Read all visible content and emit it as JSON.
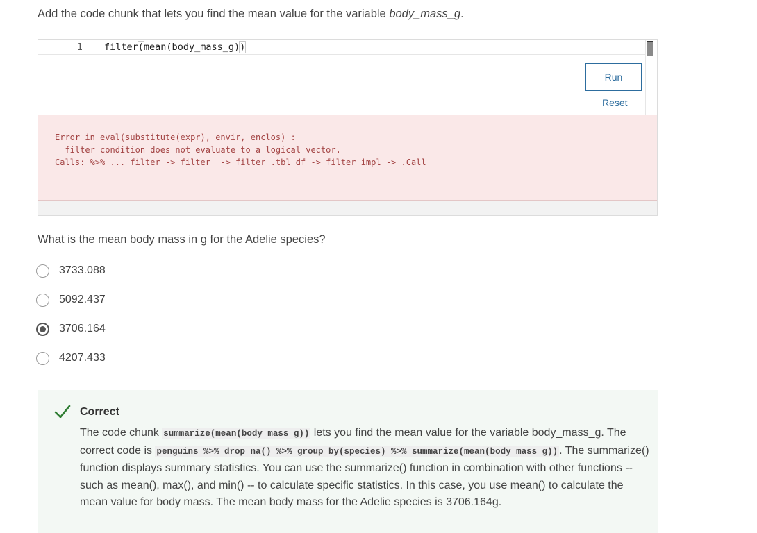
{
  "question1": {
    "prefix": "Add the code chunk that lets you find the mean value for the variable ",
    "variable": "body_mass_g",
    "suffix": "."
  },
  "editor": {
    "line_number": "1",
    "code_fn": "filter",
    "code_open": "(",
    "code_inner": "mean(body_mass_g)",
    "code_close": ")"
  },
  "buttons": {
    "run": "Run",
    "reset": "Reset"
  },
  "error": {
    "line1": "Error in eval(substitute(expr), envir, enclos) :",
    "line2": "  filter condition does not evaluate to a logical vector.",
    "line3": "Calls: %>% ... filter -> filter_ -> filter_.tbl_df -> filter_impl -> .Call"
  },
  "question2": "What is the mean body mass in g for the Adelie species?",
  "options": [
    {
      "label": "3733.088",
      "selected": false
    },
    {
      "label": "5092.437",
      "selected": false
    },
    {
      "label": "3706.164",
      "selected": true
    },
    {
      "label": "4207.433",
      "selected": false
    }
  ],
  "feedback": {
    "title": "Correct",
    "t1": "The code chunk ",
    "c1": "summarize(mean(body_mass_g))",
    "t2": " lets you find the mean value for the variable body_mass_g. The correct code is ",
    "c2": "penguins %>% drop_na() %>% group_by(species) %>% summarize(mean(body_mass_g))",
    "t3": ". The summarize() function displays summary statistics. You can use the summarize() function in combination with other functions -- such as mean(), max(), and min() -- to calculate specific statistics. In this case, you use mean() to calculate the mean value for body mass. The mean body mass for the Adelie species is 3706.164g.",
    "accent_color": "#2e7d32"
  },
  "colors": {
    "link": "#2d6d9e",
    "error_text": "#a34444",
    "error_bg": "#fae8e8",
    "feedback_bg": "#f3f8f4"
  }
}
